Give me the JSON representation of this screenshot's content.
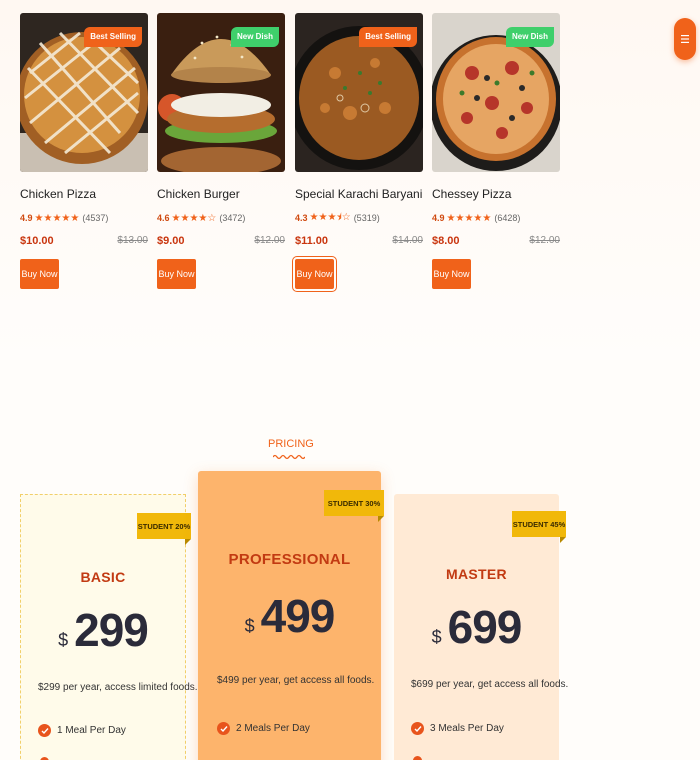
{
  "products": [
    {
      "title": "Chicken Pizza",
      "badge": "Best Selling",
      "badge_color": "orange",
      "rating": "4.9",
      "stars": "★★★★★",
      "count": "(4537)",
      "price": "$10.00",
      "old_price": "$13.00",
      "buy_label": "Buy Now"
    },
    {
      "title": "Chicken Burger",
      "badge": "New Dish",
      "badge_color": "green",
      "rating": "4.6",
      "stars": "★★★★☆",
      "count": "(3472)",
      "price": "$9.00",
      "old_price": "$12.00",
      "buy_label": "Buy Now"
    },
    {
      "title": "Special Karachi Baryani",
      "badge": "Best Selling",
      "badge_color": "orange",
      "rating": "4.3",
      "stars": "★★★⯨☆",
      "count": "(5319)",
      "price": "$11.00",
      "old_price": "$14.00",
      "buy_label": "Buy Now"
    },
    {
      "title": "Chessey Pizza",
      "badge": "New Dish",
      "badge_color": "green",
      "rating": "4.9",
      "stars": "★★★★★",
      "count": "(6428)",
      "price": "$8.00",
      "old_price": "$12.00",
      "buy_label": "Buy Now"
    }
  ],
  "pricing": {
    "section_label": "PRICING",
    "plans": [
      {
        "name": "BASIC",
        "student": "STUDENT 20%",
        "currency": "$",
        "amount": "299",
        "desc": "$299 per year, access limited foods.",
        "features": [
          "1 Meal Per Day"
        ]
      },
      {
        "name": "PROFESSIONAL",
        "student": "STUDENT 30%",
        "currency": "$",
        "amount": "499",
        "desc": "$499 per year, get access all foods.",
        "features": [
          "2 Meals Per Day"
        ]
      },
      {
        "name": "MASTER",
        "student": "STUDENT 45%",
        "currency": "$",
        "amount": "699",
        "desc": "$699 per year, get access all foods.",
        "features": [
          "3 Meals Per Day"
        ]
      }
    ]
  },
  "icons": {
    "menu": "menu-icon",
    "check": "check-icon"
  },
  "colors": {
    "accent": "#f0621a",
    "badge_green": "#3fcf6b",
    "student_badge": "#f1b80a"
  }
}
